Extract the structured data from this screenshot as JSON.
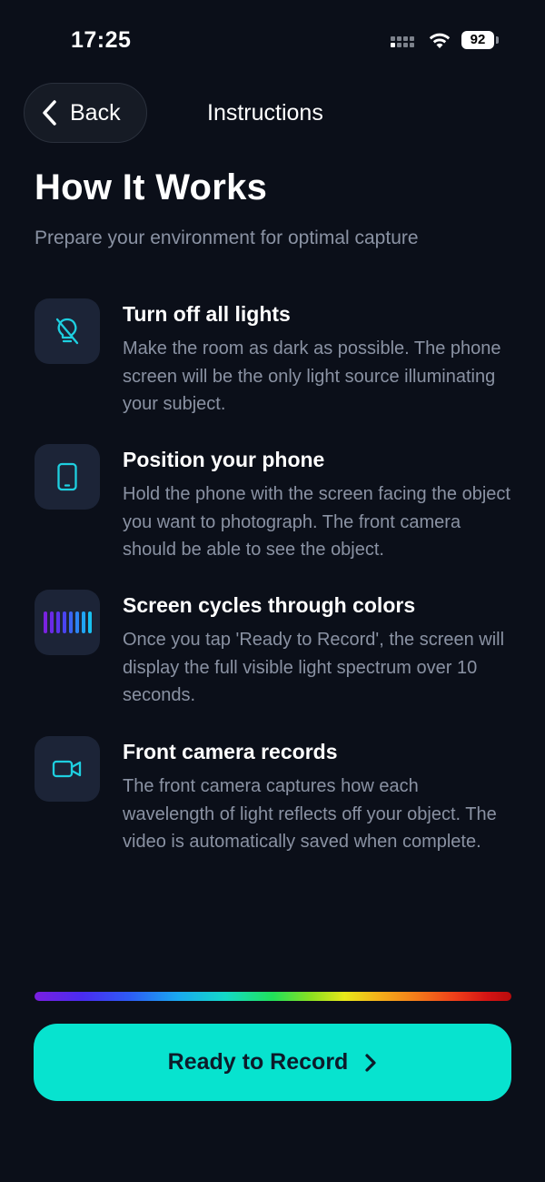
{
  "status_bar": {
    "time": "17:25",
    "battery": "92"
  },
  "nav": {
    "back_label": "Back",
    "title": "Instructions"
  },
  "header": {
    "title": "How It Works",
    "subtitle": "Prepare your environment for optimal capture"
  },
  "steps": [
    {
      "icon": "lightbulb-off-icon",
      "title": "Turn off all lights",
      "description": "Make the room as dark as possible. The phone screen will be the only light source illuminating your subject."
    },
    {
      "icon": "phone-icon",
      "title": "Position your phone",
      "description": "Hold the phone with the screen facing the object you want to photograph. The front camera should be able to see the object."
    },
    {
      "icon": "color-bars-icon",
      "title": "Screen cycles through colors",
      "description": "Once you tap 'Ready to Record', the screen will display the full visible light spectrum over 10 seconds."
    },
    {
      "icon": "video-camera-icon",
      "title": "Front camera records",
      "description": "The front camera captures how each wavelength of light reflects off your object. The video is automatically saved when complete."
    }
  ],
  "colors": {
    "accent": "#07e3cf",
    "icon_tint": "#1ecfe0",
    "background": "#0b0f19"
  },
  "footer": {
    "record_label": "Ready to Record"
  }
}
